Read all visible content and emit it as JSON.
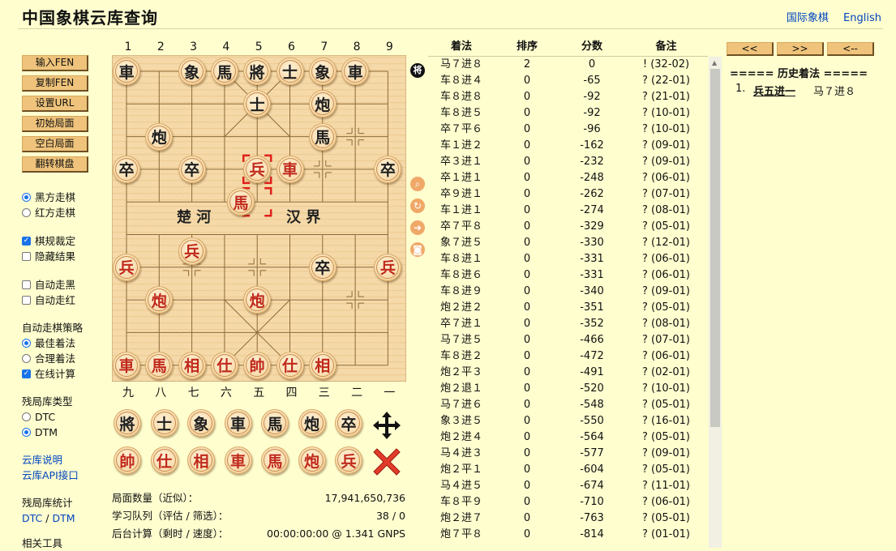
{
  "header": {
    "title": "中国象棋云库查询",
    "link_intl": "国际象棋",
    "link_english": "English"
  },
  "left": {
    "buttons": [
      "输入FEN",
      "复制FEN",
      "设置URL",
      "初始局面",
      "空白局面",
      "翻转棋盘"
    ],
    "turn": {
      "black": "黑方走棋",
      "red": "红方走棋",
      "selected": "black"
    },
    "rules": {
      "rule_judge": "棋规裁定",
      "rule_judge_checked": true,
      "hide_results": "隐藏结果",
      "hide_results_checked": false
    },
    "auto": {
      "auto_black": "自动走黑",
      "auto_red": "自动走红"
    },
    "strategy": {
      "title": "自动走棋策略",
      "best": "最佳着法",
      "reasonable": "合理着法",
      "online": "在线计算"
    },
    "endgame": {
      "title": "残局库类型",
      "dtc": "DTC",
      "dtm": "DTM",
      "selected": "DTM"
    },
    "links": {
      "cloud_help": "云库说明",
      "cloud_api": "云库API接口"
    },
    "stats": {
      "title": "残局库统计",
      "dtc": "DTC",
      "sep": "/",
      "dtm": "DTM"
    },
    "tools_title": "相关工具"
  },
  "board": {
    "top_coords": [
      "1",
      "2",
      "3",
      "4",
      "5",
      "6",
      "7",
      "8",
      "9"
    ],
    "bottom_coords": [
      "九",
      "八",
      "七",
      "六",
      "五",
      "四",
      "三",
      "二",
      "一"
    ],
    "river_left": "楚  河",
    "river_right": "汉  界",
    "turn_marker": "将",
    "pieces": [
      {
        "char": "車",
        "color": "black",
        "file": 0,
        "rank": 0
      },
      {
        "char": "象",
        "color": "black",
        "file": 2,
        "rank": 0
      },
      {
        "char": "馬",
        "color": "black",
        "file": 3,
        "rank": 0
      },
      {
        "char": "將",
        "color": "black",
        "file": 4,
        "rank": 0
      },
      {
        "char": "士",
        "color": "black",
        "file": 5,
        "rank": 0
      },
      {
        "char": "象",
        "color": "black",
        "file": 6,
        "rank": 0
      },
      {
        "char": "車",
        "color": "black",
        "file": 7,
        "rank": 0
      },
      {
        "char": "士",
        "color": "black",
        "file": 4,
        "rank": 1
      },
      {
        "char": "炮",
        "color": "black",
        "file": 6,
        "rank": 1
      },
      {
        "char": "炮",
        "color": "black",
        "file": 1,
        "rank": 2
      },
      {
        "char": "馬",
        "color": "black",
        "file": 6,
        "rank": 2
      },
      {
        "char": "卒",
        "color": "black",
        "file": 0,
        "rank": 3
      },
      {
        "char": "卒",
        "color": "black",
        "file": 2,
        "rank": 3
      },
      {
        "char": "兵",
        "color": "red",
        "file": 4,
        "rank": 3
      },
      {
        "char": "車",
        "color": "red",
        "file": 5,
        "rank": 3
      },
      {
        "char": "卒",
        "color": "black",
        "file": 8,
        "rank": 3
      },
      {
        "char": "馬",
        "color": "red",
        "file": 3.5,
        "rank": 4
      },
      {
        "char": "兵",
        "color": "red",
        "file": 2,
        "rank": 5.5
      },
      {
        "char": "兵",
        "color": "red",
        "file": 0,
        "rank": 6
      },
      {
        "char": "卒",
        "color": "black",
        "file": 6,
        "rank": 6
      },
      {
        "char": "兵",
        "color": "red",
        "file": 8,
        "rank": 6
      },
      {
        "char": "炮",
        "color": "red",
        "file": 1,
        "rank": 7
      },
      {
        "char": "炮",
        "color": "red",
        "file": 4,
        "rank": 7
      },
      {
        "char": "車",
        "color": "red",
        "file": 0,
        "rank": 9
      },
      {
        "char": "馬",
        "color": "red",
        "file": 1,
        "rank": 9
      },
      {
        "char": "相",
        "color": "red",
        "file": 2,
        "rank": 9
      },
      {
        "char": "仕",
        "color": "red",
        "file": 3,
        "rank": 9
      },
      {
        "char": "帥",
        "color": "red",
        "file": 4,
        "rank": 9
      },
      {
        "char": "仕",
        "color": "red",
        "file": 5,
        "rank": 9
      },
      {
        "char": "相",
        "color": "red",
        "file": 6,
        "rank": 9
      }
    ],
    "last_move_marks": [
      {
        "file": 4,
        "rank": 3
      },
      {
        "file": 4,
        "rank": 4
      }
    ]
  },
  "tray": {
    "black": [
      "將",
      "士",
      "象",
      "車",
      "馬",
      "炮",
      "卒"
    ],
    "red": [
      "帥",
      "仕",
      "相",
      "車",
      "馬",
      "炮",
      "兵"
    ],
    "move_icon": "move-arrows-icon",
    "delete_icon": "delete-x-icon"
  },
  "stats": [
    {
      "label": "局面数量（近似）：",
      "value": "17,941,650,736"
    },
    {
      "label": "学习队列（评估 / 筛选）：",
      "value": "38 / 0"
    },
    {
      "label": "后台计算（剩时 / 速度）：",
      "value": "00:00:00:00 @ 1.341 GNPS"
    }
  ],
  "moves": {
    "headers": [
      "着法",
      "排序",
      "分数",
      "备注"
    ],
    "rows": [
      [
        "马７进８",
        "2",
        "0",
        "! (32-02)"
      ],
      [
        "车８进４",
        "0",
        "-65",
        "? (22-01)"
      ],
      [
        "车８进８",
        "0",
        "-92",
        "? (21-01)"
      ],
      [
        "车８进５",
        "0",
        "-92",
        "? (10-01)"
      ],
      [
        "卒７平６",
        "0",
        "-96",
        "? (10-01)"
      ],
      [
        "车１进２",
        "0",
        "-162",
        "? (09-01)"
      ],
      [
        "卒３进１",
        "0",
        "-232",
        "? (09-01)"
      ],
      [
        "卒１进１",
        "0",
        "-248",
        "? (06-01)"
      ],
      [
        "卒９进１",
        "0",
        "-262",
        "? (07-01)"
      ],
      [
        "车１进１",
        "0",
        "-274",
        "? (08-01)"
      ],
      [
        "卒７平８",
        "0",
        "-329",
        "? (05-01)"
      ],
      [
        "象７进５",
        "0",
        "-330",
        "? (12-01)"
      ],
      [
        "车８进１",
        "0",
        "-331",
        "? (06-01)"
      ],
      [
        "车８进６",
        "0",
        "-331",
        "? (06-01)"
      ],
      [
        "车８进９",
        "0",
        "-340",
        "? (09-01)"
      ],
      [
        "炮２进２",
        "0",
        "-351",
        "? (05-01)"
      ],
      [
        "卒７进１",
        "0",
        "-352",
        "? (08-01)"
      ],
      [
        "马７进５",
        "0",
        "-466",
        "? (07-01)"
      ],
      [
        "车８进２",
        "0",
        "-472",
        "? (06-01)"
      ],
      [
        "炮２平３",
        "0",
        "-491",
        "? (02-01)"
      ],
      [
        "炮２退１",
        "0",
        "-520",
        "? (10-01)"
      ],
      [
        "马７进６",
        "0",
        "-548",
        "? (05-01)"
      ],
      [
        "象３进５",
        "0",
        "-550",
        "? (16-01)"
      ],
      [
        "炮２进４",
        "0",
        "-564",
        "? (05-01)"
      ],
      [
        "马４进３",
        "0",
        "-577",
        "? (09-01)"
      ],
      [
        "炮２平１",
        "0",
        "-604",
        "? (05-01)"
      ],
      [
        "马４进５",
        "0",
        "-674",
        "? (11-01)"
      ],
      [
        "车８平９",
        "0",
        "-710",
        "? (06-01)"
      ],
      [
        "炮２进７",
        "0",
        "-763",
        "? (05-01)"
      ],
      [
        "炮７平８",
        "0",
        "-814",
        "? (01-01)"
      ]
    ]
  },
  "history": {
    "nav": [
      "<<",
      ">>",
      "<--"
    ],
    "title": "===== 历史着法 =====",
    "moves": [
      {
        "num": "1.",
        "red": "兵五进一",
        "black": "马７进８"
      }
    ]
  }
}
